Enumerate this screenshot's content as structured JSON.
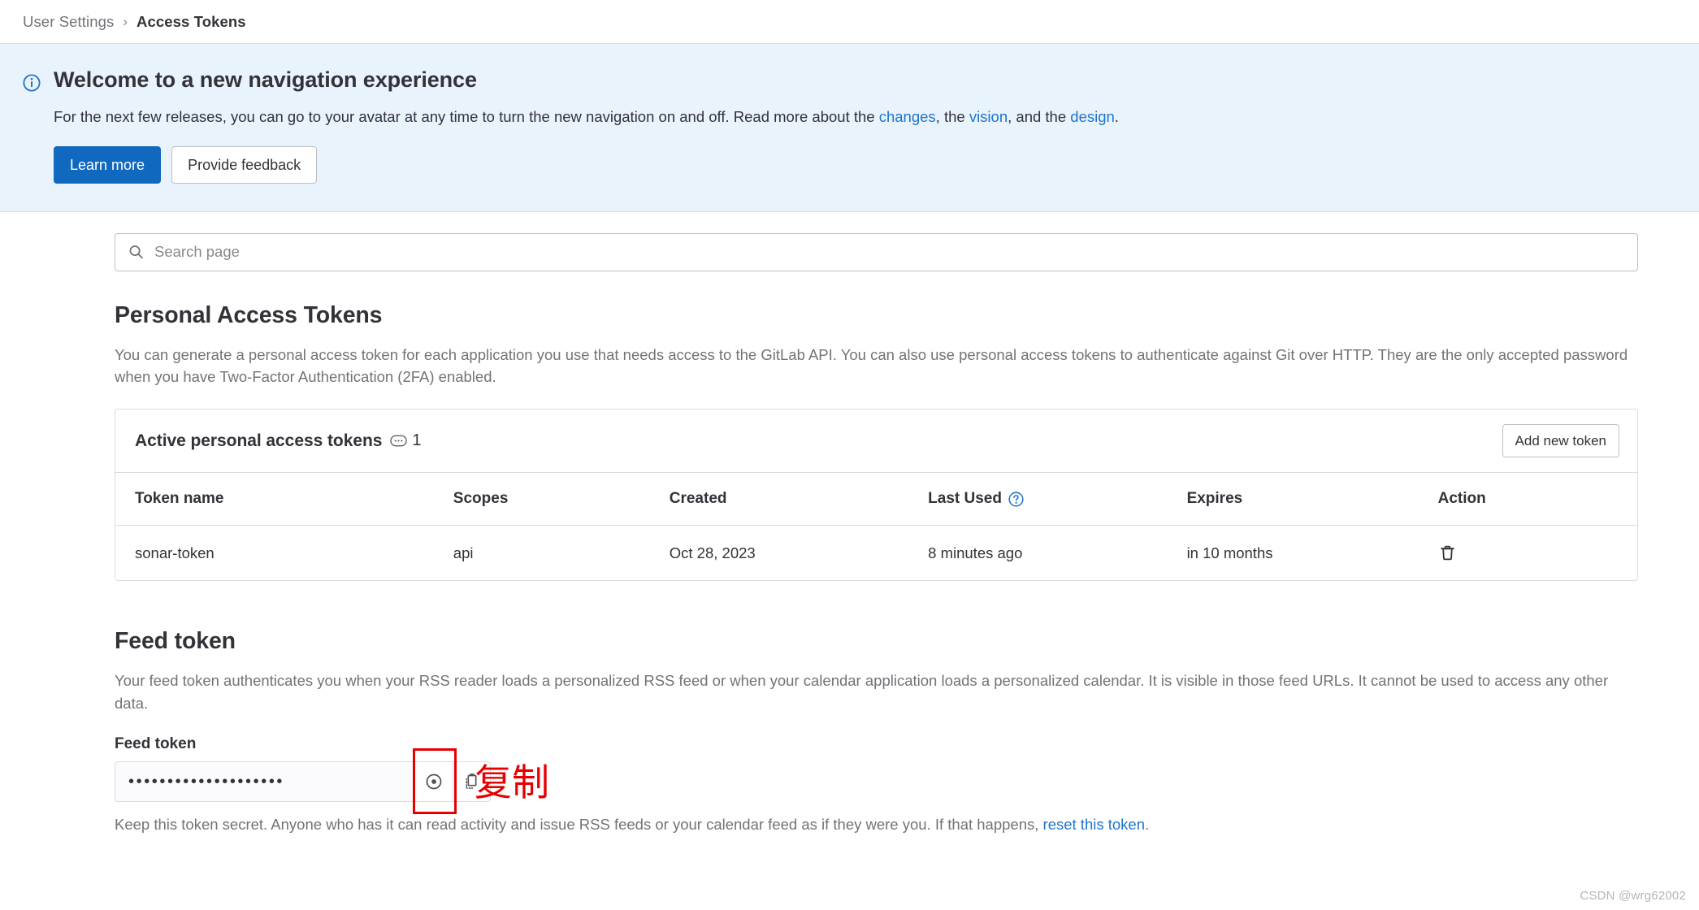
{
  "breadcrumb": {
    "parent": "User Settings",
    "separator": "›",
    "current": "Access Tokens"
  },
  "banner": {
    "icon": "info-circle-icon",
    "title": "Welcome to a new navigation experience",
    "text_before": "For the next few releases, you can go to your avatar at any time to turn the new navigation on and off. Read more about the ",
    "link_changes": "changes",
    "text_mid1": ", the ",
    "link_vision": "vision",
    "text_mid2": ", and the ",
    "link_design": "design",
    "text_after": ".",
    "primary_button": "Learn more",
    "secondary_button": "Provide feedback",
    "background_color": "#e9f3fc",
    "primary_color": "#1068bf"
  },
  "search": {
    "icon": "search-icon",
    "placeholder": "Search page",
    "value": ""
  },
  "personal_access_tokens": {
    "title": "Personal Access Tokens",
    "description_line1": "You can generate a personal access token for each application you use that needs access to the GitLab API. You can also use personal access tokens to authenticate against Git over HTTP.",
    "description_line2": "They are the only accepted password when you have Two-Factor Authentication (2FA) enabled.",
    "card_title": "Active personal access tokens",
    "count_icon": "token-count-icon",
    "count": "1",
    "add_button": "Add new token",
    "table": {
      "columns": [
        "Token name",
        "Scopes",
        "Created",
        "Last Used",
        "Expires",
        "Action"
      ],
      "last_used_help_icon": "question-circle-icon",
      "rows": [
        {
          "token_name": "sonar-token",
          "scopes": "api",
          "created": "Oct 28, 2023",
          "last_used": "8 minutes ago",
          "expires": "in 10 months",
          "action_icon": "trash-icon"
        }
      ]
    }
  },
  "feed_token": {
    "title": "Feed token",
    "description_line1": "Your feed token authenticates you when your RSS reader loads a personalized RSS feed or when your calendar application loads a personalized calendar. It is visible in those feed URLs. It",
    "description_line2": "cannot be used to access any other data.",
    "field_label": "Feed token",
    "masked_value": "••••••••••••••••••••",
    "reveal_icon": "eye-icon",
    "copy_icon": "clipboard-copy-icon",
    "help_before": "Keep this token secret. Anyone who has it can read activity and issue RSS feeds or your calendar feed as if they were you. If that happens, ",
    "help_link": "reset this token",
    "help_after": "."
  },
  "annotation": {
    "label": "复制",
    "color": "#e60000",
    "target": "clipboard-copy-icon"
  },
  "watermark": "CSDN @wrg62002"
}
